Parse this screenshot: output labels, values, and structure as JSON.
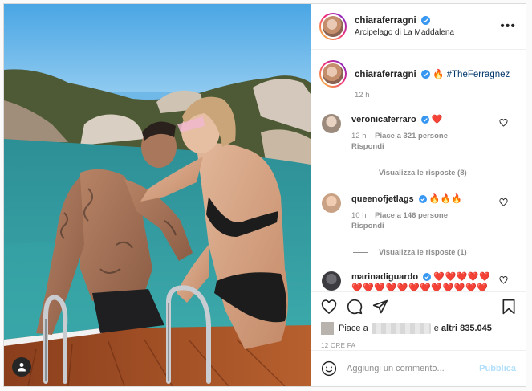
{
  "post": {
    "author": "chiaraferragni",
    "location": "Arcipelago di La Maddalena",
    "caption_emoji": "🔥",
    "caption_hashtag": "#TheFerragnez",
    "caption_time": "12 h",
    "more_label": "•••"
  },
  "comments": [
    {
      "user": "veronicaferraro",
      "text": "❤️",
      "time": "12 h",
      "likes": "Piace a 321 persone",
      "reply": "Rispondi",
      "view_replies": "Visualizza le risposte (8)",
      "avatar_color": "#9c8b7d"
    },
    {
      "user": "queenofjetlags",
      "text": "🔥🔥🔥",
      "time": "10 h",
      "likes": "Piace a 146 persone",
      "reply": "Rispondi",
      "view_replies": "Visualizza le risposte (1)",
      "avatar_color": "#c9a184"
    },
    {
      "user": "marinadiguardo",
      "text": "❤️❤️❤️❤️❤️❤️❤️❤️❤️❤️❤️❤️❤️❤️❤️❤️❤️❤️❤️❤️",
      "avatar_color": "#3b3b40"
    }
  ],
  "likes": {
    "prefix": "Piace a",
    "joiner": "e",
    "others": "altri 835.045"
  },
  "posted_ago": "12 ORE FA",
  "add_comment": {
    "placeholder": "Aggiungi un commento...",
    "publish": "Pubblica"
  },
  "icons": {
    "verified": "verified-badge-icon",
    "like": "heart-icon",
    "comment": "comment-icon",
    "share": "paper-plane-icon",
    "save": "bookmark-icon",
    "emoji": "emoji-smile-icon",
    "more": "more-options-icon",
    "user_tag": "user-tag-icon"
  },
  "colors": {
    "verified_blue": "#3897f0",
    "link": "#00376b",
    "muted": "#8e8e8e",
    "publish_disabled": "#b2dffc",
    "heart_red": "#ed4956"
  }
}
